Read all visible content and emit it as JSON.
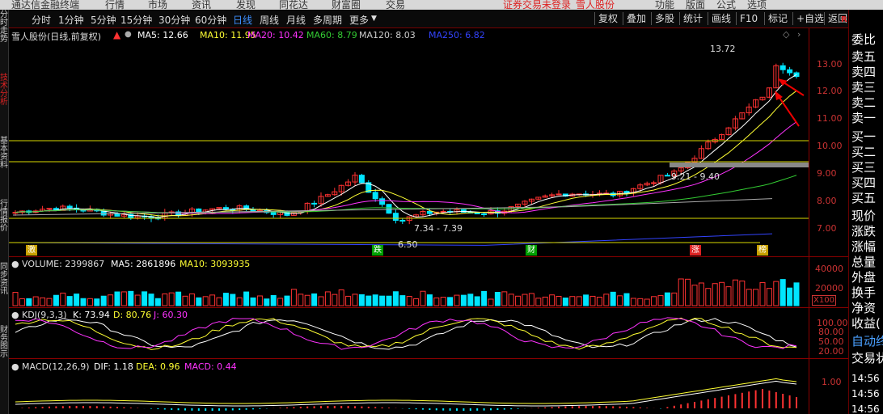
{
  "top_menu": {
    "app_title": "通达信金融终端",
    "items": [
      "行情",
      "市场",
      "资讯",
      "发现",
      "同花达",
      "财富圈",
      "交易"
    ],
    "trade_notice": "证券交易未登录",
    "stock_link": "雪人股份",
    "right_items": [
      "功能",
      "版面",
      "公式",
      "选项"
    ]
  },
  "left_tabs": [
    "分时走势",
    "技术分析",
    "基本资料",
    "行情报价",
    "同步资讯",
    "财务图示"
  ],
  "periods": [
    "分时",
    "1分钟",
    "5分钟",
    "15分钟",
    "30分钟",
    "60分钟",
    "日线",
    "周线",
    "月线",
    "多周期",
    "更多"
  ],
  "active_period": "日线",
  "toolbar": [
    "复权",
    "叠加",
    "多股",
    "统计",
    "画线",
    "F10",
    "标记",
    "+自选",
    "返回"
  ],
  "panel_r": "R",
  "main_legend": {
    "stock_name": "雪人股份(日线,前复权)",
    "ma5": "MA5: 12.66",
    "ma10": "MA10: 11.95",
    "ma20": "MA20: 10.42",
    "ma60": "MA60: 8.79",
    "ma120": "MA120: 8.03",
    "ma250": "MA250: 6.82"
  },
  "colors": {
    "up": "#ff3232",
    "down": "#00e5ff",
    "ma5": "#ffffff",
    "ma10": "#ffff33",
    "ma20": "#ff33ff",
    "ma60": "#33cc33",
    "ma120": "#aaaaaa",
    "ma250": "#3344ff",
    "axis": "#c33333"
  },
  "price_axis": [
    "13.00",
    "12.00",
    "11.00",
    "10.00",
    "9.00",
    "8.00",
    "7.00"
  ],
  "price_annotations": {
    "high": "13.72",
    "low": "6.50",
    "range1": "7.34 - 7.39",
    "range2": "9.21 - 9.40"
  },
  "badges": [
    {
      "text": "激",
      "color": "#c8a000"
    },
    {
      "text": "跌",
      "color": "#00a000"
    },
    {
      "text": "财",
      "color": "#00a000"
    },
    {
      "text": "涨",
      "color": "#d22"
    },
    {
      "text": "榜",
      "color": "#c8a000"
    }
  ],
  "volume_legend": {
    "title": "VOLUME: 2399867",
    "ma5": "MA5: 2861896",
    "ma10": "MA10: 3093935"
  },
  "volume_axis": [
    "40000",
    "20000"
  ],
  "volume_unit": "X100",
  "kdj_legend": {
    "title": "KDJ(9,3,3)",
    "k": "K: 73.94",
    "d": "D: 80.76",
    "j": "J: 60.30"
  },
  "kdj_axis": [
    "100.00",
    "80.00",
    "50.00",
    "20.00"
  ],
  "macd_legend": {
    "title": "MACD(12,26,9)",
    "dif": "DIF: 1.18",
    "dea": "DEA: 0.96",
    "macd": "MACD: 0.44"
  },
  "macd_axis": [
    "1.00"
  ],
  "right_panel": {
    "items": [
      "委比",
      "卖五",
      "卖四",
      "卖三",
      "卖二",
      "卖一",
      "买一",
      "买二",
      "买三",
      "买四",
      "买五",
      "现价",
      "涨跌",
      "涨幅",
      "总量",
      "外盘",
      "换手",
      "净资",
      "收益(",
      "自动终",
      "交易状"
    ],
    "times": [
      "14:56",
      "14:56",
      "14:56"
    ]
  }
}
